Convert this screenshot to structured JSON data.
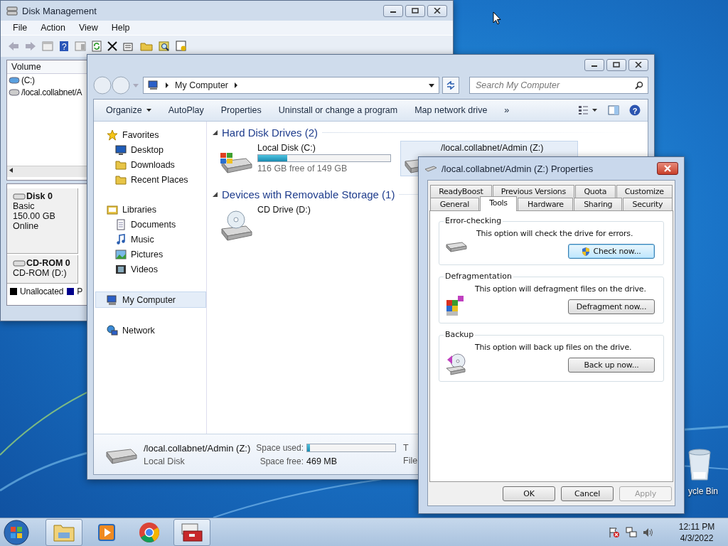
{
  "desktop": {
    "recycle_bin_label": "ycle Bin"
  },
  "disk_management": {
    "title": "Disk Management",
    "menu": [
      "File",
      "Action",
      "View",
      "Help"
    ],
    "column": "Volume",
    "help_glyph": "?",
    "volumes": [
      {
        "name": "(C:)"
      },
      {
        "name": "/local.collabnet/A"
      }
    ],
    "disks": [
      {
        "name": "Disk 0",
        "lines": [
          "Basic",
          "150.00 GB",
          "Online"
        ]
      },
      {
        "name": "CD-ROM 0",
        "lines": [
          "CD-ROM (D:)"
        ]
      }
    ],
    "legend": [
      {
        "label": "Unallocated",
        "color": "#000000"
      },
      {
        "label": "P",
        "color": "#00008b"
      }
    ]
  },
  "explorer": {
    "breadcrumb": "My Computer",
    "search": {
      "placeholder": "Search My Computer"
    },
    "help_glyph": "?",
    "commands": [
      "Organize",
      "AutoPlay",
      "Properties",
      "Uninstall or change a program",
      "Map network drive",
      "»"
    ],
    "nav": [
      {
        "label": "Favorites",
        "selected": false,
        "children": [
          {
            "label": "Desktop",
            "selected": false
          },
          {
            "label": "Downloads",
            "selected": false
          },
          {
            "label": "Recent Places",
            "selected": false
          }
        ]
      },
      {
        "label": "Libraries",
        "selected": false,
        "children": [
          {
            "label": "Documents",
            "selected": false
          },
          {
            "label": "Music",
            "selected": false
          },
          {
            "label": "Pictures",
            "selected": false
          },
          {
            "label": "Videos",
            "selected": false
          }
        ]
      },
      {
        "label": "My Computer",
        "selected": true
      },
      {
        "label": "Network",
        "selected": false
      }
    ],
    "groups": [
      {
        "title": "Hard Disk Drives (2)",
        "items": [
          {
            "kind": "system",
            "name": "Local Disk (C:)",
            "level": 0.22,
            "detail": "116 GB free of 149 GB",
            "selected": false
          },
          {
            "kind": "disk",
            "name": "/local.collabnet/Admin (Z:)",
            "selected": true
          }
        ]
      },
      {
        "title": "Devices with Removable Storage (1)",
        "items": [
          {
            "kind": "cd",
            "name": "CD Drive (D:)",
            "selected": false
          }
        ]
      }
    ],
    "details": {
      "name": "/local.collabnet/Admin (Z:)",
      "type": "Local Disk",
      "used_label": "Space used:",
      "level": 0.03,
      "free_label": "Space free:",
      "free": "469 MB",
      "column_3": [
        "T",
        "File"
      ]
    }
  },
  "dialog": {
    "title": "/local.collabnet/Admin (Z:) Properties",
    "tab_rows": [
      [
        {
          "label": "ReadyBoost",
          "selected": false
        },
        {
          "label": "Previous Versions",
          "selected": false
        },
        {
          "label": "Quota",
          "selected": false
        },
        {
          "label": "Customize",
          "selected": false
        }
      ],
      [
        {
          "label": "General",
          "selected": false
        },
        {
          "label": "Tools",
          "selected": true
        },
        {
          "label": "Hardware",
          "selected": false
        },
        {
          "label": "Sharing",
          "selected": false
        },
        {
          "label": "Security",
          "selected": false
        }
      ]
    ],
    "sections": [
      {
        "title": "Error-checking",
        "text": "This option will check the drive for errors.",
        "button": "Check now...",
        "shield": true,
        "focused": true
      },
      {
        "title": "Defragmentation",
        "text": "This option will defragment files on the drive.",
        "button": "Defragment now...",
        "shield": false,
        "focused": false
      },
      {
        "title": "Backup",
        "text": "This option will back up files on the drive.",
        "button": "Back up now...",
        "shield": false,
        "focused": false
      }
    ],
    "buttons": [
      {
        "label": "OK",
        "disabled": false
      },
      {
        "label": "Cancel",
        "disabled": false
      },
      {
        "label": "Apply",
        "disabled": true
      }
    ]
  },
  "taskbar": {
    "apps": [
      {
        "active": true
      },
      {
        "active": false
      },
      {
        "active": false
      },
      {
        "active": true
      }
    ],
    "time": "12:11 PM",
    "date": "4/3/2022"
  }
}
